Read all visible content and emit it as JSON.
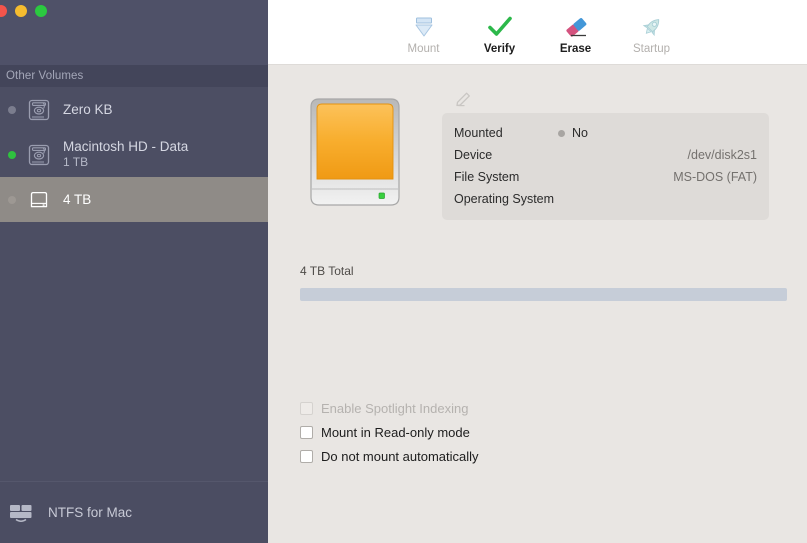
{
  "window": {
    "traffic_lights": [
      {
        "name": "close",
        "color": "#f4544b"
      },
      {
        "name": "minimize",
        "color": "#f6bc2f"
      },
      {
        "name": "maximize",
        "color": "#2bc940"
      }
    ]
  },
  "sidebar": {
    "section_header": "Other Volumes",
    "volumes": [
      {
        "name": "Zero KB",
        "subtitle": "",
        "icon": "internal-disk-icon",
        "status": "unmounted",
        "status_color": "#7b7d8e",
        "selected": false
      },
      {
        "name": "Macintosh HD - Data",
        "subtitle": "1 TB",
        "icon": "internal-disk-icon",
        "status": "mounted",
        "status_color": "#2fc23f",
        "selected": false
      },
      {
        "name": "4 TB",
        "subtitle": "",
        "icon": "external-disk-icon",
        "status": "unmounted",
        "status_color": "#9d9893",
        "selected": true
      }
    ],
    "footer": {
      "label": "NTFS for Mac",
      "icon": "stacked-disks-icon"
    }
  },
  "toolbar": {
    "items": [
      {
        "label": "Mount",
        "icon": "mount-icon",
        "enabled": false
      },
      {
        "label": "Verify",
        "icon": "verify-icon",
        "enabled": true
      },
      {
        "label": "Erase",
        "icon": "erase-icon",
        "enabled": true
      },
      {
        "label": "Startup",
        "icon": "startup-icon",
        "enabled": false
      }
    ]
  },
  "main": {
    "disk_icon": "external-hard-drive-icon",
    "rename_icon": "pencil-icon",
    "info": {
      "rows": [
        {
          "key": "Mounted",
          "value": "No",
          "align": "left",
          "has_dot": true
        },
        {
          "key": "Device",
          "value": "/dev/disk2s1",
          "align": "right",
          "has_dot": false
        },
        {
          "key": "File System",
          "value": "MS-DOS (FAT)",
          "align": "right",
          "has_dot": false
        },
        {
          "key": "Operating System",
          "value": "",
          "align": "right",
          "has_dot": false
        }
      ]
    },
    "capacity": {
      "label": "4 TB Total",
      "used_percent": 0,
      "bar_color": "#c6cdd8"
    },
    "options": [
      {
        "label": "Enable Spotlight Indexing",
        "checked": false,
        "enabled": false
      },
      {
        "label": "Mount in Read-only mode",
        "checked": false,
        "enabled": true
      },
      {
        "label": "Do not mount automatically",
        "checked": false,
        "enabled": true
      }
    ]
  },
  "colors": {
    "sidebar_bg": "#4c4e63",
    "sidebar_selected": "#8f8b87",
    "main_bg": "#e9e6e3",
    "info_card_bg": "#dedbd8",
    "disk_orange": "#f5a623"
  }
}
